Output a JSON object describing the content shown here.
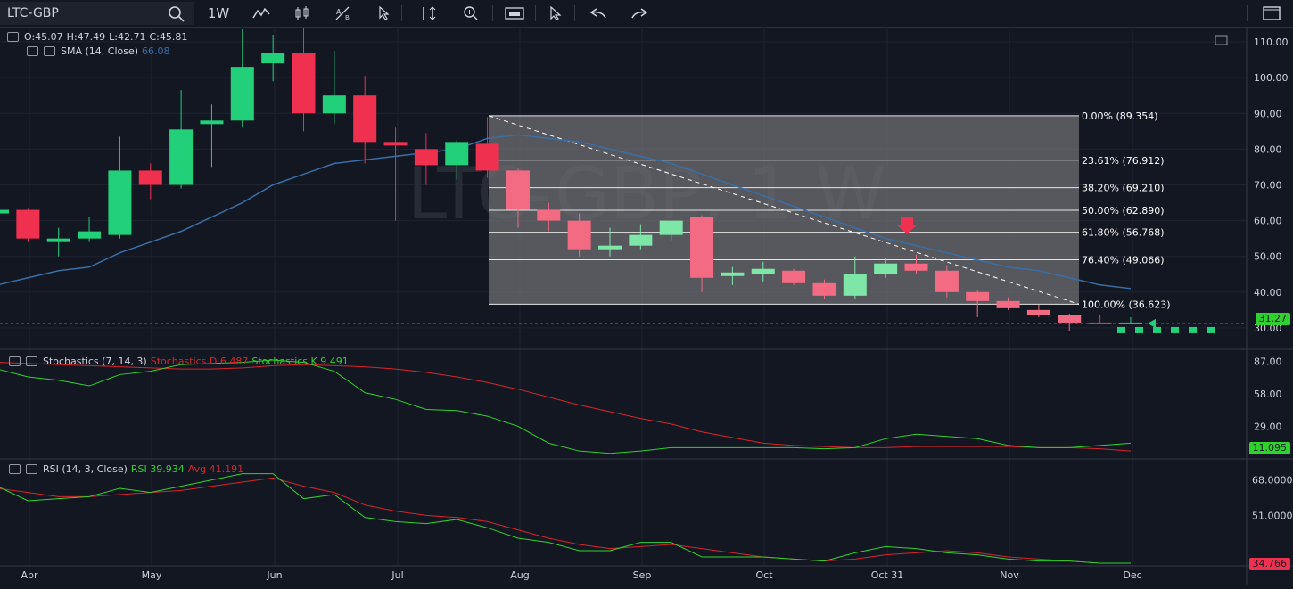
{
  "toolbar": {
    "symbol": "LTC-GBP",
    "interval": "1W",
    "icons": [
      "search-icon",
      "line-tool-icon",
      "candle-style-icon",
      "text-tool-icon",
      "cursor-icon",
      "measure-icon",
      "zoom-icon",
      "screenshot-icon",
      "pointer-select-icon",
      "undo-icon",
      "redo-icon",
      "fullscreen-icon"
    ]
  },
  "watermark": "LTC-GBP, 1 W",
  "ohlc": {
    "o": "O:45.07",
    "h": "H:47.49",
    "l": "L:42.71",
    "c": "C:45.81"
  },
  "sma": {
    "label": "SMA (14, Close)",
    "value": "66.08"
  },
  "stoch": {
    "label": "Stochastics (7, 14, 3)",
    "d_label": "Stochastics D 6.487",
    "k_label": "Stochastics K 9.491"
  },
  "rsi": {
    "label": "RSI (14, 3, Close)",
    "rsi_label": "RSI 39.934",
    "avg_label": "Avg 41.191"
  },
  "price_axis": [
    "110.00",
    "100.00",
    "90.00",
    "80.00",
    "70.00",
    "60.00",
    "50.00",
    "40.00",
    "30.00"
  ],
  "stoch_axis": [
    "87.00",
    "58.00",
    "29.00"
  ],
  "rsi_axis": [
    "68.0000",
    "51.0000"
  ],
  "last_price": "31.27",
  "stoch_last": "11.095",
  "rsi_last": "34.766",
  "fib_levels": [
    {
      "label": "0.00% (89.354)",
      "price": 89.354
    },
    {
      "label": "23.61% (76.912)",
      "price": 76.912
    },
    {
      "label": "38.20% (69.210)",
      "price": 69.21
    },
    {
      "label": "50.00% (62.890)",
      "price": 62.89
    },
    {
      "label": "61.80% (56.768)",
      "price": 56.768
    },
    {
      "label": "76.40% (49.066)",
      "price": 49.066
    },
    {
      "label": "100.00% (36.623)",
      "price": 36.623
    }
  ],
  "time_axis": [
    "Apr",
    "May",
    "Jun",
    "Jul",
    "Aug",
    "Sep",
    "Oct",
    "Oct 31",
    "Nov",
    "Dec"
  ],
  "colors": {
    "bg": "#131722",
    "up": "#22d07a",
    "down": "#f0304f",
    "sma": "#3a6ea5",
    "stochD": "#d9242b",
    "stochK": "#2fd12f",
    "fib_fill": "#6f6f73"
  },
  "chart_data": {
    "type": "candlestick",
    "candles": [
      {
        "o": 62,
        "h": 64,
        "l": 60,
        "c": 63
      },
      {
        "o": 63,
        "h": 63.5,
        "l": 54,
        "c": 55
      },
      {
        "o": 54,
        "h": 58,
        "l": 50,
        "c": 55
      },
      {
        "o": 55,
        "h": 61,
        "l": 54,
        "c": 57
      },
      {
        "o": 56,
        "h": 83.5,
        "l": 55,
        "c": 74
      },
      {
        "o": 74,
        "h": 76,
        "l": 66,
        "c": 70
      },
      {
        "o": 70,
        "h": 96.5,
        "l": 69,
        "c": 85.5
      },
      {
        "o": 87,
        "h": 92.5,
        "l": 75,
        "c": 88
      },
      {
        "o": 88,
        "h": 113.5,
        "l": 86,
        "c": 103
      },
      {
        "o": 104,
        "h": 112,
        "l": 99,
        "c": 107
      },
      {
        "o": 107,
        "h": 114,
        "l": 85,
        "c": 90
      },
      {
        "o": 90,
        "h": 107.5,
        "l": 87,
        "c": 95
      },
      {
        "o": 95,
        "h": 100.5,
        "l": 76,
        "c": 82
      },
      {
        "o": 82,
        "h": 86,
        "l": 60,
        "c": 81
      },
      {
        "o": 80,
        "h": 84.5,
        "l": 70,
        "c": 75.5
      },
      {
        "o": 75.5,
        "h": 82.5,
        "l": 71.5,
        "c": 82
      },
      {
        "o": 81.5,
        "h": 89,
        "l": 72,
        "c": 74
      },
      {
        "o": 74,
        "h": 74.5,
        "l": 58,
        "c": 63
      },
      {
        "o": 63,
        "h": 65,
        "l": 57,
        "c": 60
      },
      {
        "o": 60,
        "h": 62,
        "l": 50,
        "c": 52
      },
      {
        "o": 52,
        "h": 58,
        "l": 50,
        "c": 53
      },
      {
        "o": 53,
        "h": 59,
        "l": 52,
        "c": 56
      },
      {
        "o": 56,
        "h": 60,
        "l": 54.5,
        "c": 60
      },
      {
        "o": 61,
        "h": 61.5,
        "l": 40,
        "c": 44
      },
      {
        "o": 44.5,
        "h": 47,
        "l": 42,
        "c": 45.5
      },
      {
        "o": 45,
        "h": 48.5,
        "l": 43,
        "c": 46.5
      },
      {
        "o": 46,
        "h": 46.5,
        "l": 42,
        "c": 42.5
      },
      {
        "o": 42.5,
        "h": 43.5,
        "l": 38,
        "c": 39
      },
      {
        "o": 39,
        "h": 50,
        "l": 38,
        "c": 45
      },
      {
        "o": 45,
        "h": 49.5,
        "l": 44,
        "c": 48
      },
      {
        "o": 48,
        "h": 50.5,
        "l": 45,
        "c": 46
      },
      {
        "o": 46,
        "h": 47.5,
        "l": 38.5,
        "c": 40
      },
      {
        "o": 40,
        "h": 40.5,
        "l": 33,
        "c": 37.5
      },
      {
        "o": 37.5,
        "h": 38.5,
        "l": 35,
        "c": 35.5
      },
      {
        "o": 35,
        "h": 36.5,
        "l": 33,
        "c": 33.5
      },
      {
        "o": 33.5,
        "h": 34,
        "l": 29,
        "c": 31.5
      },
      {
        "o": 31.5,
        "h": 33.5,
        "l": 31,
        "c": 31.27
      },
      {
        "o": 31.27,
        "h": 33,
        "l": 31,
        "c": 31.5
      }
    ],
    "sma": [
      42,
      44,
      46,
      47,
      51,
      54,
      57,
      61,
      65,
      70,
      73,
      76,
      77,
      78,
      79,
      80,
      83,
      84,
      83,
      82,
      80,
      78,
      76,
      73,
      70,
      67,
      64,
      61,
      58,
      55,
      53,
      51,
      49,
      47,
      46,
      44,
      42,
      41
    ],
    "stoch_d": [
      86,
      85,
      84,
      83,
      82,
      81,
      80,
      80,
      81,
      83,
      84,
      83,
      82,
      80,
      77,
      73,
      68,
      62,
      55,
      48,
      42,
      36,
      31,
      24,
      19,
      14,
      12,
      11,
      10,
      10,
      11,
      11,
      11,
      11,
      10,
      10,
      9,
      7
    ],
    "stoch_k": [
      80,
      73,
      70,
      65,
      75,
      78,
      84,
      85,
      86,
      88,
      86,
      78,
      59,
      53,
      44,
      43,
      38,
      29,
      14,
      7,
      5,
      7,
      10,
      10,
      10,
      10,
      10,
      9,
      10,
      18,
      22,
      20,
      18,
      12,
      10,
      10,
      12,
      14
    ],
    "rsi": [
      65,
      58,
      59,
      60,
      64,
      62,
      65,
      68,
      71,
      71,
      59,
      61,
      50,
      48,
      47,
      49,
      45,
      40,
      38,
      34,
      34,
      38,
      38,
      31,
      31,
      31,
      30,
      29,
      33,
      36,
      35,
      33,
      32,
      30,
      29,
      29,
      28,
      28
    ],
    "rsi_avg": [
      64,
      62,
      60,
      60,
      61,
      62,
      63,
      65,
      67,
      69,
      65,
      62,
      56,
      53,
      51,
      50,
      48,
      44,
      40,
      37,
      35,
      36,
      37,
      35,
      33,
      31,
      30,
      29,
      30,
      32,
      33,
      34,
      33,
      31,
      30,
      29,
      28,
      28
    ]
  }
}
